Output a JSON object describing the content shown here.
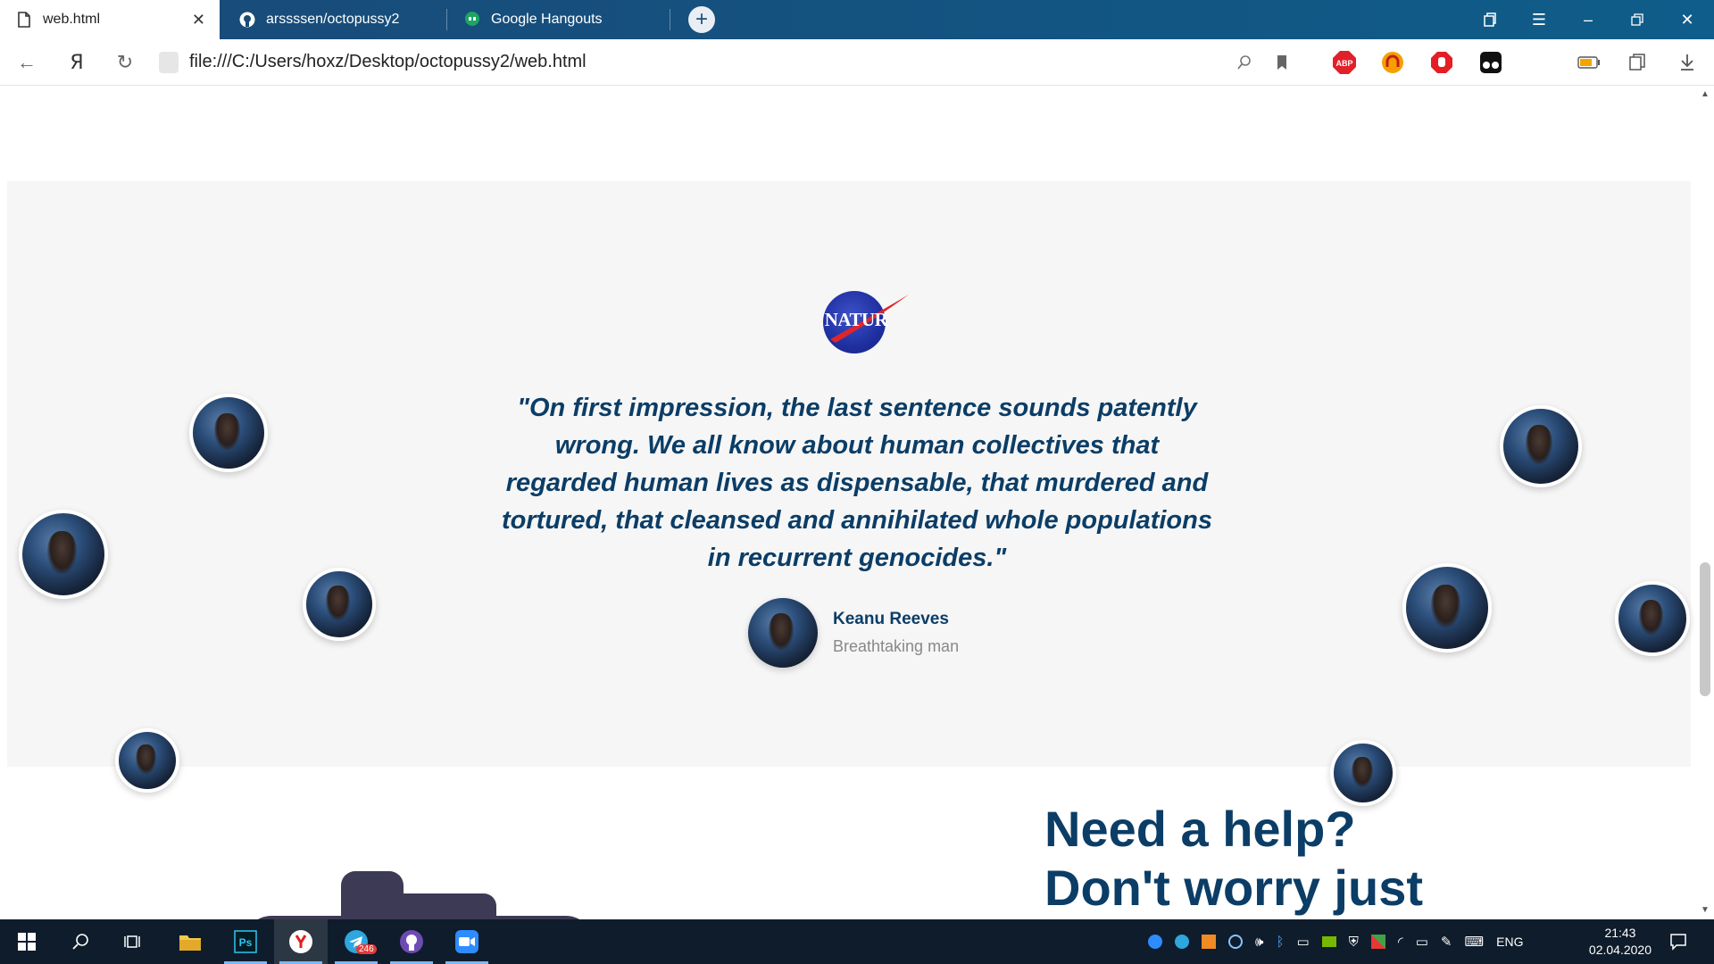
{
  "browser": {
    "tabs": [
      {
        "label": "web.html",
        "active": true
      },
      {
        "label": "arssssen/octopussy2",
        "active": false
      },
      {
        "label": "Google Hangouts",
        "active": false
      }
    ],
    "url": "file:///C:/Users/hoxz/Desktop/octopussy2/web.html",
    "extensions": [
      "ABP"
    ]
  },
  "testimonial": {
    "logo_text": "NATUR",
    "quote": "\"On first impression, the last sentence sounds patently wrong. We all know about human collectives that regarded human lives as dispensable, that murdered and tortured, that cleansed and annihilated whole populations in recurrent genocides.\"",
    "author_name": "Keanu Reeves",
    "author_role": "Breathtaking man"
  },
  "help": {
    "line1": "Need a help?",
    "line2": "Don't worry just"
  },
  "taskbar": {
    "telegram_badge": "246",
    "language": "ENG",
    "time": "21:43",
    "date": "02.04.2020"
  }
}
